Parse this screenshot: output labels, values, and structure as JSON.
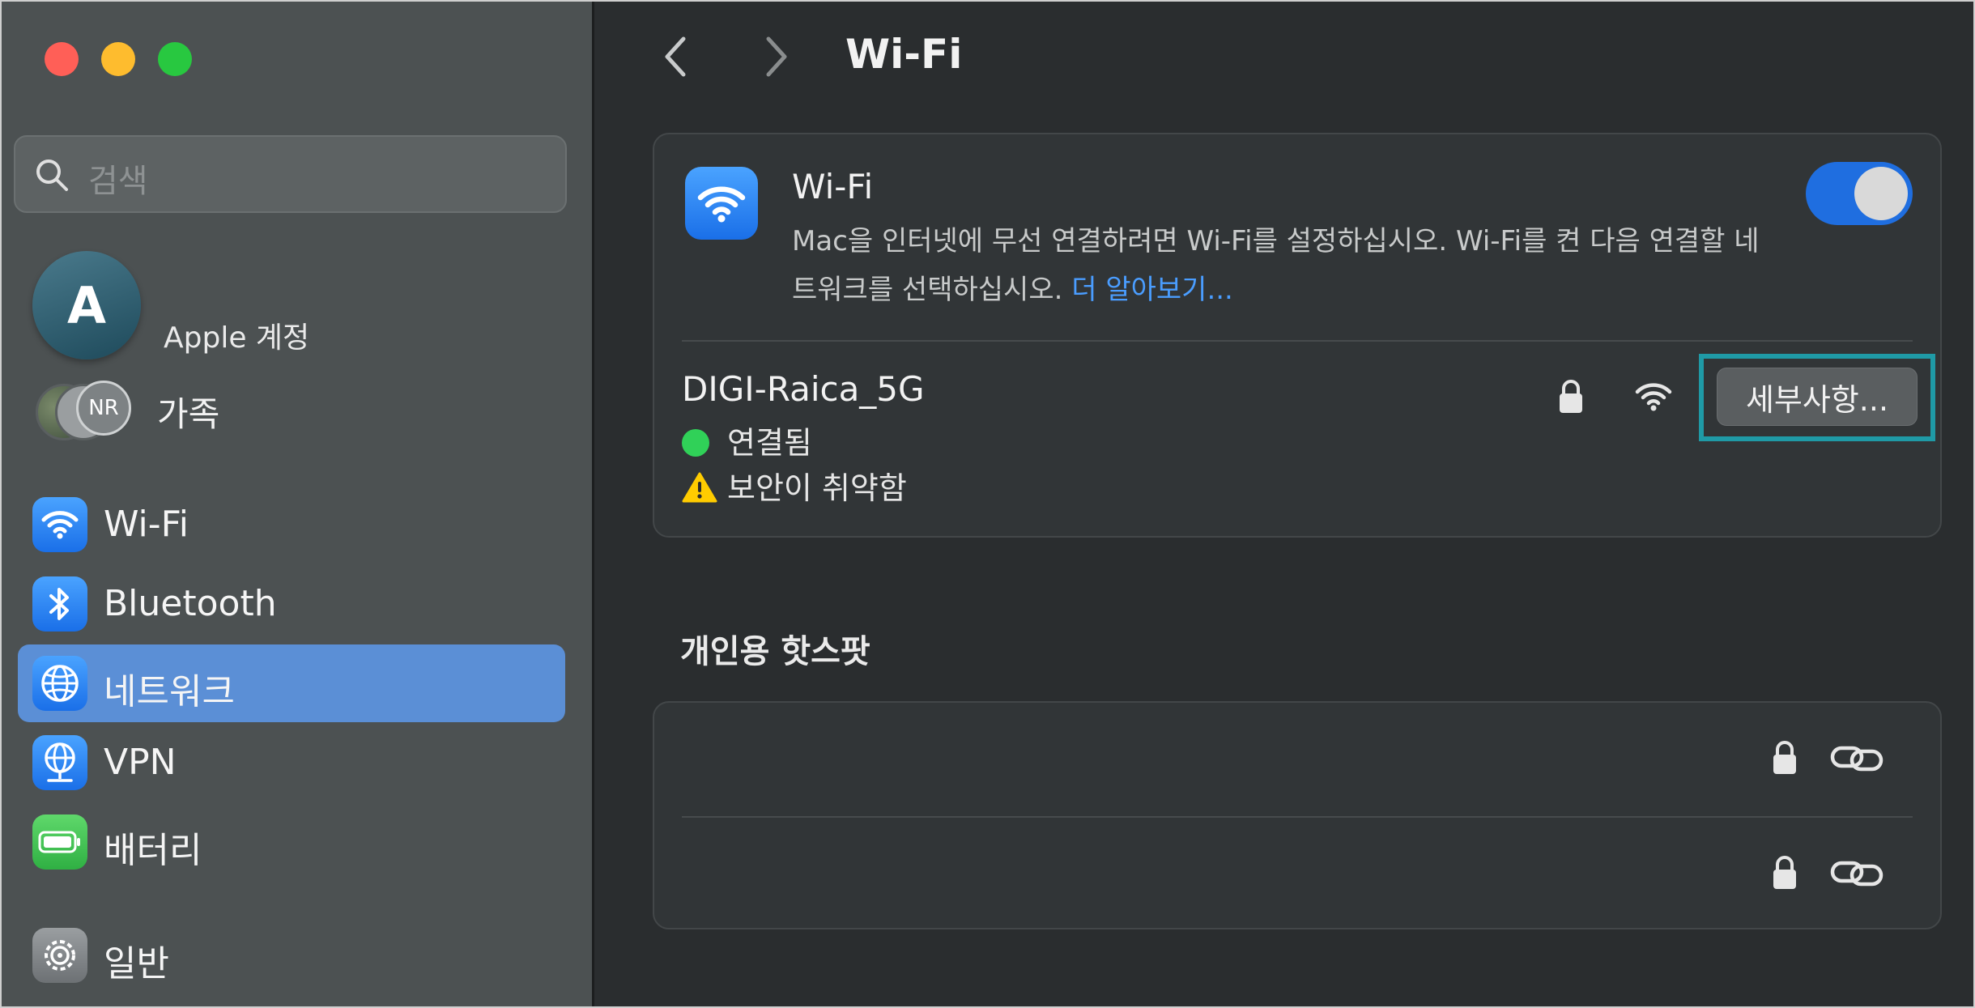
{
  "window": {
    "traffic_lights": {
      "close": "#ff5f57",
      "minimize": "#febc2e",
      "zoom": "#28c840"
    }
  },
  "sidebar": {
    "search": {
      "placeholder": "검색"
    },
    "account": {
      "avatar_initial": "A",
      "label": "Apple 계정"
    },
    "family": {
      "avatar_initials": "NR",
      "label": "가족"
    },
    "items": [
      {
        "label": "Wi-Fi",
        "icon": "wifi-icon"
      },
      {
        "label": "Bluetooth",
        "icon": "bluetooth-icon"
      },
      {
        "label": "네트워크",
        "icon": "globe-icon",
        "selected": true
      },
      {
        "label": "VPN",
        "icon": "vpn-globe-icon"
      },
      {
        "label": "배터리",
        "icon": "battery-icon"
      },
      {
        "label": "일반",
        "icon": "gear-icon"
      }
    ]
  },
  "main": {
    "title": "Wi-Fi",
    "wifi_card": {
      "heading": "Wi-Fi",
      "description": "Mac을 인터넷에 무선 연결하려면 Wi-Fi를 설정하십시오. Wi-Fi를 켠 다음 연결할 네트워크를 선택하십시오.",
      "learn_more": "더 알아보기...",
      "toggle_on": true
    },
    "network": {
      "name": "DIGI-Raica_5G",
      "status": "연결됨",
      "warning": "보안이 취약함",
      "details_button": "세부사항..."
    },
    "hotspot": {
      "section_title": "개인용 핫스팟",
      "rows": [
        {
          "icons": [
            "lock-icon",
            "link-icon"
          ]
        },
        {
          "icons": [
            "lock-icon",
            "link-icon"
          ]
        }
      ]
    }
  },
  "colors": {
    "accent": "#1f6ee0",
    "selected_sidebar": "#5b8fd6",
    "link": "#4a9dff",
    "connected": "#30d158",
    "highlight_box": "#1f9aa6"
  }
}
